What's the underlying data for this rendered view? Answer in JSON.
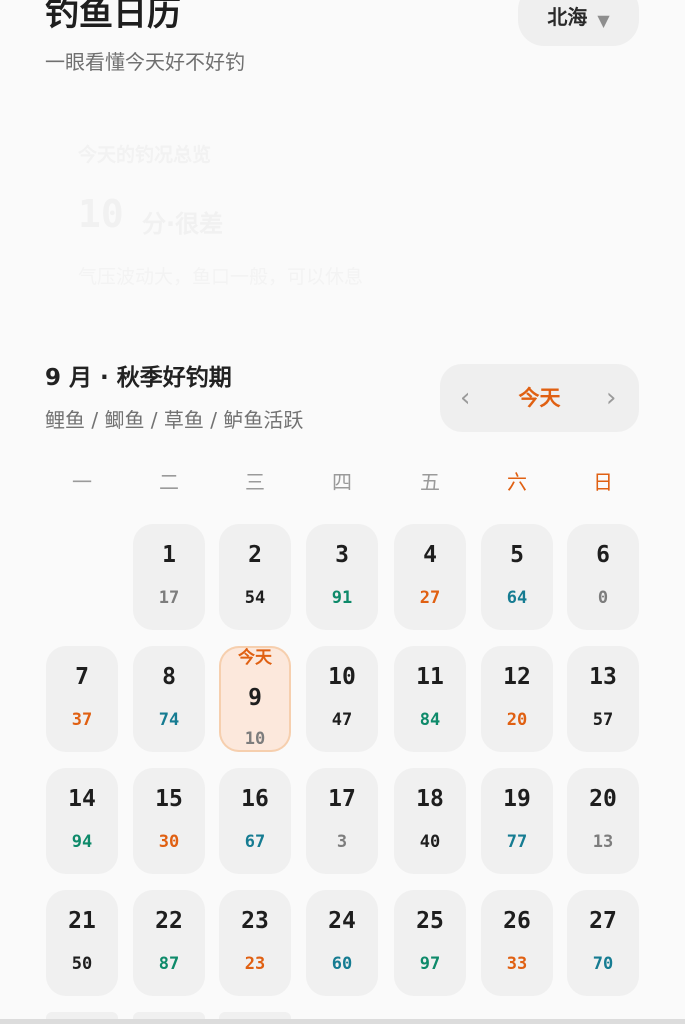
{
  "header": {
    "title": "钓鱼日历",
    "subtitle": "一眼看懂今天好不好钓",
    "region": "北海",
    "region_arrow_icon": "caret-down-icon"
  },
  "summary": {
    "label": "今天的钓况总览",
    "score": "10",
    "score_text": "分·很差",
    "description": "气压波动大，鱼口一般，可以休息"
  },
  "month": {
    "title": "9 月 · 秋季好钓期",
    "fish": "鲤鱼 / 鲫鱼 / 草鱼 / 鲈鱼活跃",
    "nav_prev": "‹",
    "nav_today": "今天",
    "nav_next": "›"
  },
  "weekdays": [
    "一",
    "二",
    "三",
    "四",
    "五",
    "六",
    "日"
  ],
  "today_tag": "今天",
  "colors": {
    "accent": "#e06012",
    "gray": "#7d7d7d",
    "black": "#1f1f1f",
    "green": "#0e8a6a",
    "orange": "#e06012",
    "blue": "#167c92"
  },
  "days": [
    {
      "day": "1",
      "score": "17",
      "color": "gray"
    },
    {
      "day": "2",
      "score": "54",
      "color": "black"
    },
    {
      "day": "3",
      "score": "91",
      "color": "green"
    },
    {
      "day": "4",
      "score": "27",
      "color": "orange"
    },
    {
      "day": "5",
      "score": "64",
      "color": "blue"
    },
    {
      "day": "6",
      "score": "0",
      "color": "gray"
    },
    {
      "day": "7",
      "score": "37",
      "color": "orange"
    },
    {
      "day": "8",
      "score": "74",
      "color": "blue"
    },
    {
      "day": "9",
      "score": "10",
      "color": "gray",
      "today": true
    },
    {
      "day": "10",
      "score": "47",
      "color": "black"
    },
    {
      "day": "11",
      "score": "84",
      "color": "green"
    },
    {
      "day": "12",
      "score": "20",
      "color": "orange"
    },
    {
      "day": "13",
      "score": "57",
      "color": "black"
    },
    {
      "day": "14",
      "score": "94",
      "color": "green"
    },
    {
      "day": "15",
      "score": "30",
      "color": "orange"
    },
    {
      "day": "16",
      "score": "67",
      "color": "blue"
    },
    {
      "day": "17",
      "score": "3",
      "color": "gray"
    },
    {
      "day": "18",
      "score": "40",
      "color": "black"
    },
    {
      "day": "19",
      "score": "77",
      "color": "blue"
    },
    {
      "day": "20",
      "score": "13",
      "color": "gray"
    },
    {
      "day": "21",
      "score": "50",
      "color": "black"
    },
    {
      "day": "22",
      "score": "87",
      "color": "green"
    },
    {
      "day": "23",
      "score": "23",
      "color": "orange"
    },
    {
      "day": "24",
      "score": "60",
      "color": "blue"
    },
    {
      "day": "25",
      "score": "97",
      "color": "green"
    },
    {
      "day": "26",
      "score": "33",
      "color": "orange"
    },
    {
      "day": "27",
      "score": "70",
      "color": "blue"
    }
  ]
}
